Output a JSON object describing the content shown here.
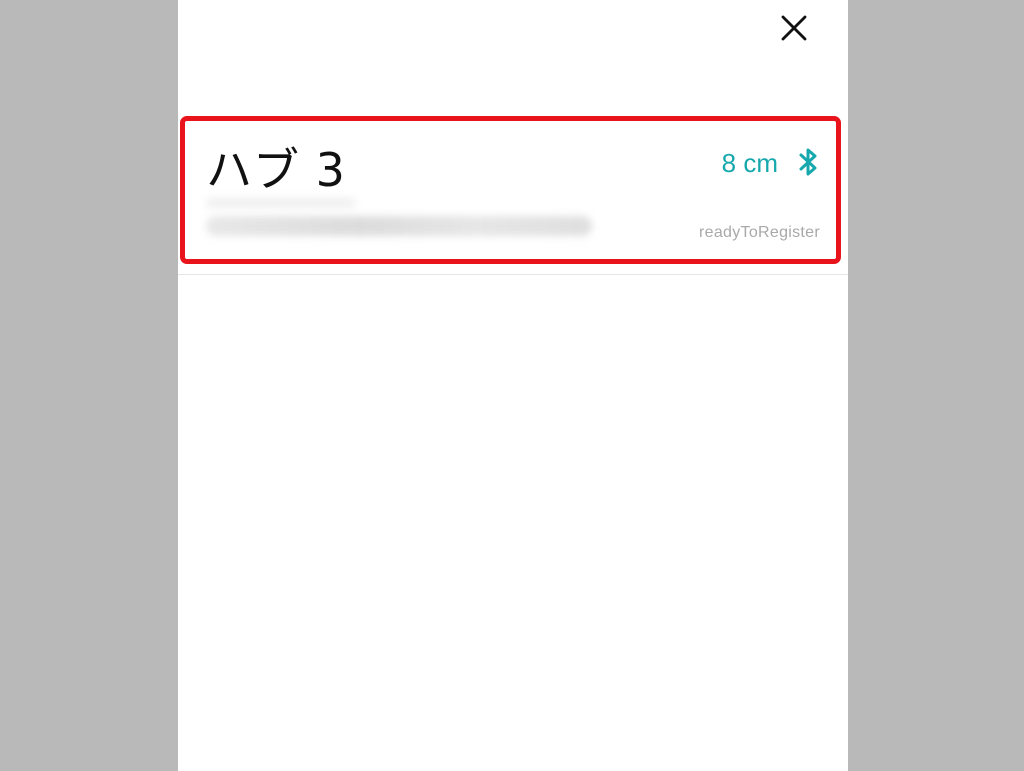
{
  "dialog": {
    "close_icon": "close-icon"
  },
  "device": {
    "name": "ハブ 3",
    "distance": "8 cm",
    "connection_icon": "bluetooth-icon",
    "status": "readyToRegister"
  },
  "colors": {
    "backdrop": "#b9b9b9",
    "panel": "#ffffff",
    "highlight": "#e8131b",
    "accent": "#17a8ad",
    "status_text": "#a9a9a9"
  }
}
